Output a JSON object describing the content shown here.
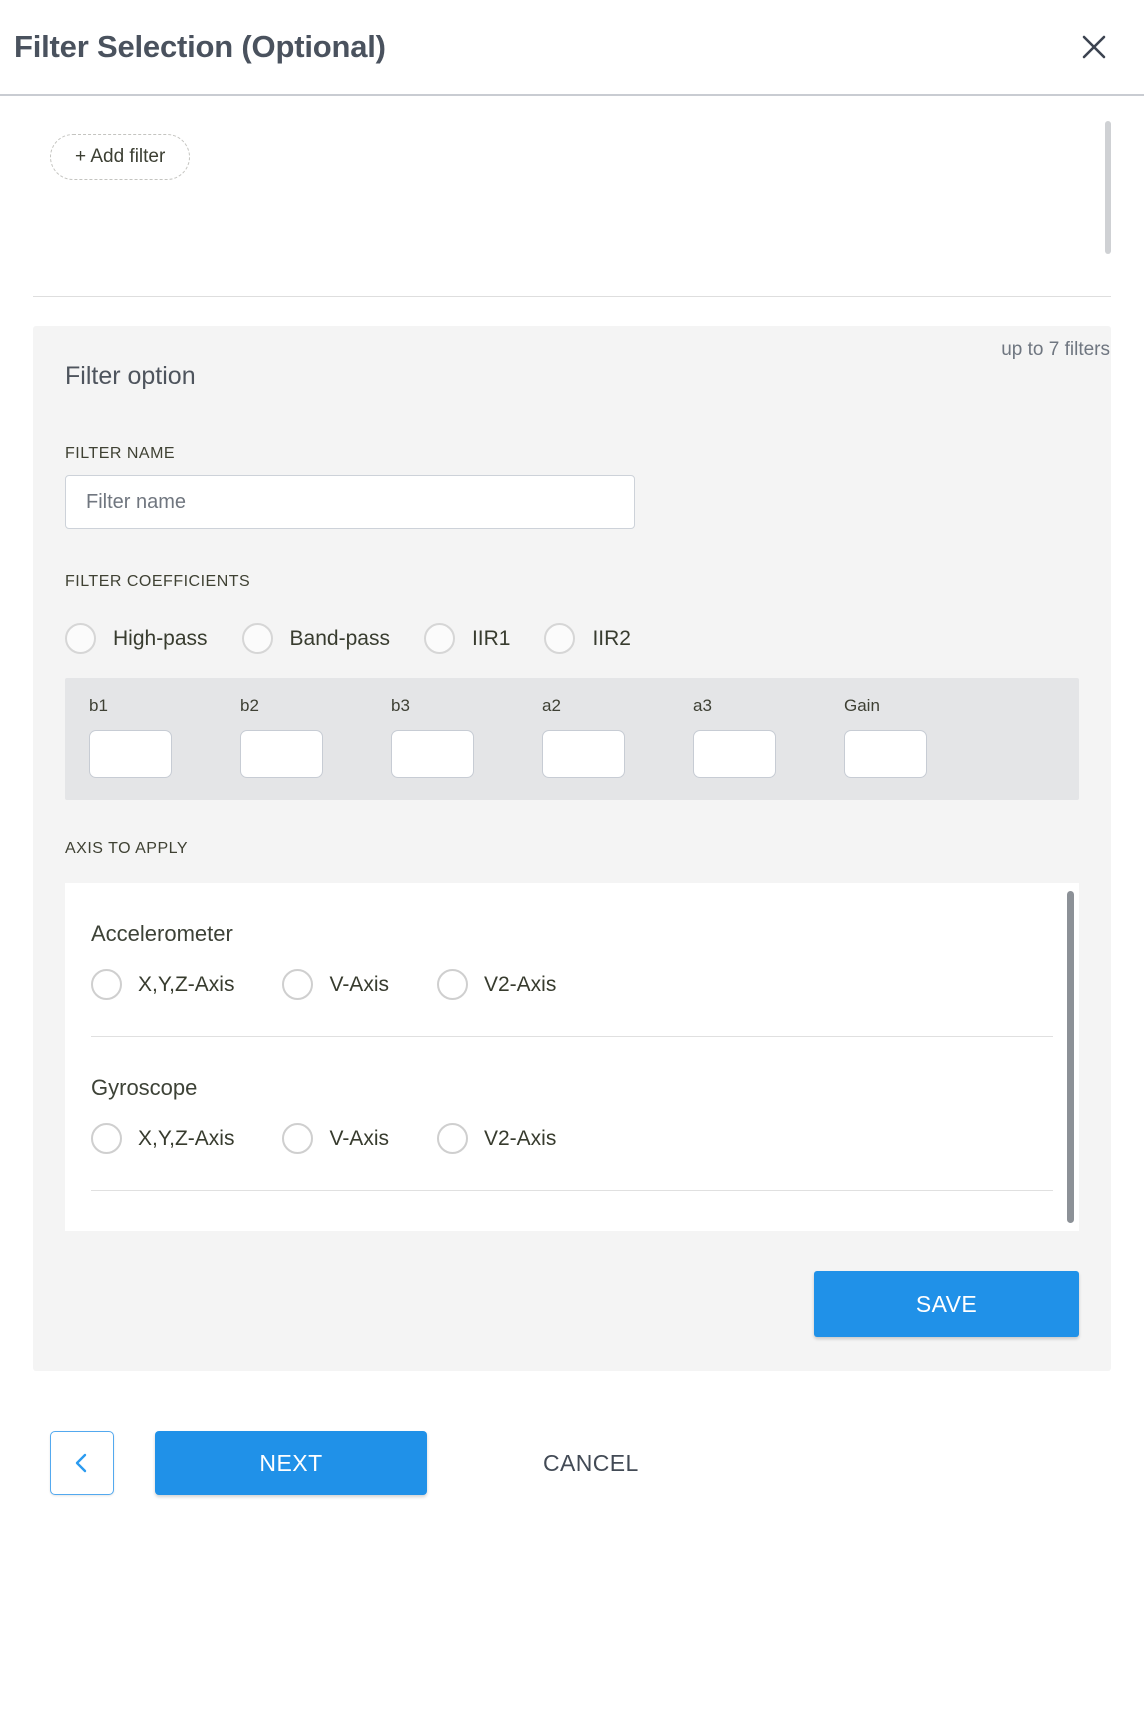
{
  "dialog": {
    "title": "Filter Selection (Optional)",
    "close_icon": "close-icon"
  },
  "filters_area": {
    "add_filter_label": "+ Add filter",
    "limit_note": "up to 7 filters"
  },
  "filter_option": {
    "heading": "Filter option",
    "name_field": {
      "label": "FILTER NAME",
      "placeholder": "Filter name",
      "value": ""
    },
    "coefficients": {
      "label": "FILTER COEFFICIENTS",
      "types": [
        {
          "label": "High-pass",
          "selected": false
        },
        {
          "label": "Band-pass",
          "selected": false
        },
        {
          "label": "IIR1",
          "selected": false
        },
        {
          "label": "IIR2",
          "selected": false
        }
      ],
      "fields": [
        {
          "name": "b1",
          "value": ""
        },
        {
          "name": "b2",
          "value": ""
        },
        {
          "name": "b3",
          "value": ""
        },
        {
          "name": "a2",
          "value": ""
        },
        {
          "name": "a3",
          "value": ""
        },
        {
          "name": "Gain",
          "value": ""
        }
      ]
    },
    "axis": {
      "label": "AXIS TO APPLY",
      "groups": [
        {
          "title": "Accelerometer",
          "options": [
            {
              "label": "X,Y,Z-Axis",
              "selected": false
            },
            {
              "label": "V-Axis",
              "selected": false
            },
            {
              "label": "V2-Axis",
              "selected": false
            }
          ]
        },
        {
          "title": "Gyroscope",
          "options": [
            {
              "label": "X,Y,Z-Axis",
              "selected": false
            },
            {
              "label": "V-Axis",
              "selected": false
            },
            {
              "label": "V2-Axis",
              "selected": false
            }
          ]
        }
      ]
    },
    "save_label": "SAVE"
  },
  "footer": {
    "back_icon": "chevron-left-icon",
    "next_label": "NEXT",
    "cancel_label": "CANCEL"
  },
  "colors": {
    "primary": "#2091e8",
    "card_bg": "#f4f4f4",
    "coef_bg": "#e4e5e7",
    "title_text": "#4a525e"
  }
}
